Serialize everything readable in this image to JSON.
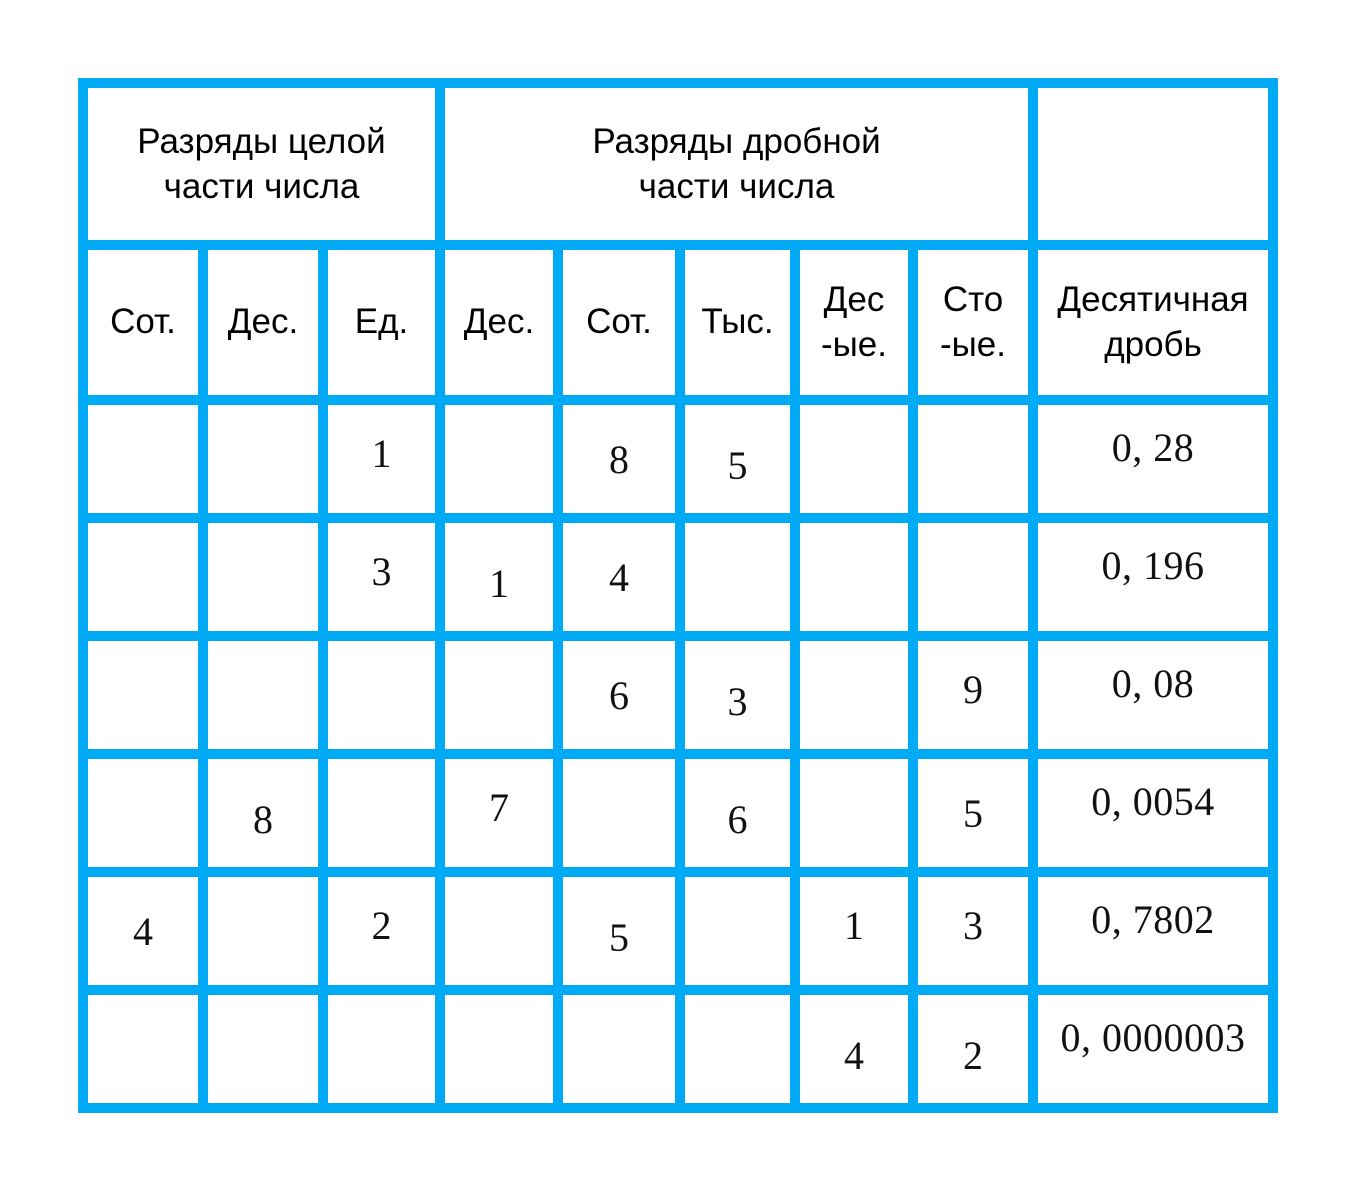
{
  "colors": {
    "grid": "#00AAF5",
    "text": "#000000",
    "cell_background": "#FFFFFF",
    "page_background": "#FFFFFF"
  },
  "table": {
    "group_headers": [
      {
        "label_lines": [
          "Разряды целой",
          "части числа"
        ],
        "span": 3,
        "align": "center"
      },
      {
        "label_lines": [
          "Разряды дробной",
          "части числа"
        ],
        "span": 5,
        "align": "left"
      },
      {
        "label_lines": [
          "",
          ""
        ],
        "span": 1,
        "align": "center"
      }
    ],
    "column_headers": [
      {
        "lines": [
          "Сот."
        ]
      },
      {
        "lines": [
          "Дес."
        ]
      },
      {
        "lines": [
          "Ед."
        ]
      },
      {
        "lines": [
          "Дес."
        ]
      },
      {
        "lines": [
          "Сот."
        ]
      },
      {
        "lines": [
          "Тыс."
        ]
      },
      {
        "lines": [
          "Дес",
          "-ые."
        ]
      },
      {
        "lines": [
          "Сто",
          "-ые."
        ]
      },
      {
        "lines": [
          "Десятичная",
          "дробь"
        ]
      }
    ],
    "rows": [
      {
        "cells": [
          "",
          "",
          "1",
          "",
          "8",
          "5",
          "",
          ""
        ],
        "fraction": "0, 28"
      },
      {
        "cells": [
          "",
          "",
          "3",
          "1",
          "4",
          "",
          "",
          ""
        ],
        "fraction": "0, 196"
      },
      {
        "cells": [
          "",
          "",
          "",
          "",
          "6",
          "3",
          "",
          "9"
        ],
        "fraction": "0, 08"
      },
      {
        "cells": [
          "",
          "8",
          "",
          "7",
          "",
          "6",
          "",
          "5"
        ],
        "fraction": "0, 0054"
      },
      {
        "cells": [
          "4",
          "",
          "2",
          "",
          "5",
          "",
          "1",
          "3"
        ],
        "fraction": "0, 7802"
      },
      {
        "cells": [
          "",
          "",
          "",
          "",
          "",
          "",
          "4",
          "2"
        ],
        "fraction": "0, 0000003"
      }
    ]
  }
}
